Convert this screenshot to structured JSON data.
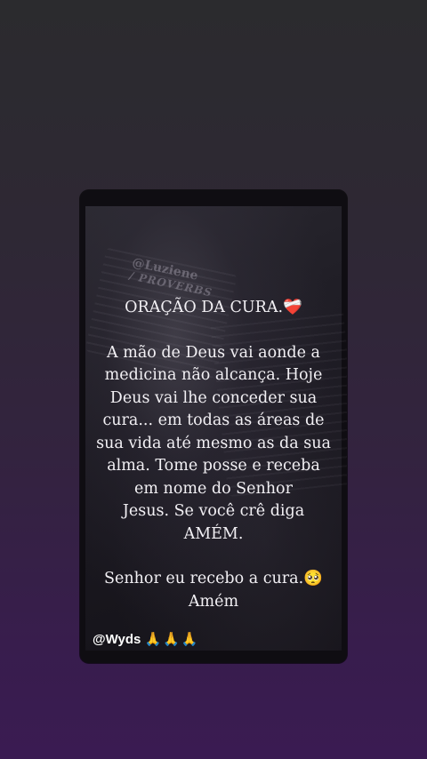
{
  "post": {
    "title": "ORAÇÃO DA CURA.❤️‍🩹",
    "body_lines": [
      "A mão de Deus vai aonde a",
      "medicina não alcança. Hoje",
      "Deus vai lhe conceder sua",
      "cura... em todas as áreas de",
      "sua vida até mesmo as da sua",
      "alma. Tome posse e receba",
      "em nome do Senhor",
      "Jesus. Se você crê diga",
      "AMÉM."
    ],
    "closing_line_1": "Senhor eu recebo a cura.🥺",
    "closing_line_2": "Amém",
    "watermark_name": "@Luziene",
    "watermark_sub": "/ PROVERBS"
  },
  "author": {
    "handle": "@Wyds",
    "emojis": "🙏🙏🙏"
  },
  "colors": {
    "background_top": "#2b2b2e",
    "background_bottom": "#3a1b52",
    "text": "#f2f0f4"
  }
}
